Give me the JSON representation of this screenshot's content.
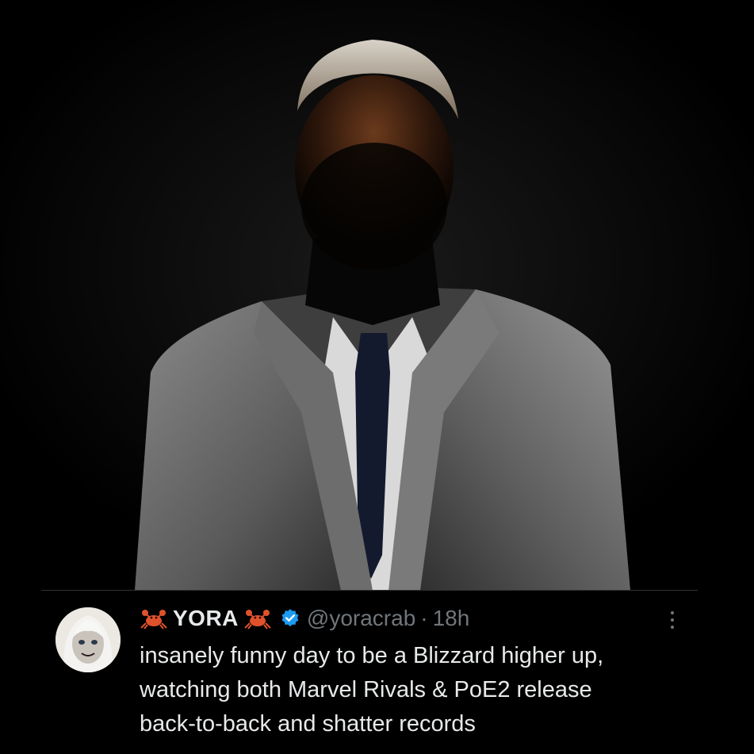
{
  "tweet": {
    "display_name": "YORA",
    "handle": "@yoracrab",
    "separator": "·",
    "time": "18h",
    "text_lines": [
      "insanely funny day to be a Blizzard higher up,",
      "watching both Marvel Rivals & PoE2 release",
      "back-to-back and shatter records"
    ],
    "icons": [
      "crab-emoji",
      "verified-badge",
      "more-options"
    ]
  },
  "colors": {
    "background": "#000000",
    "primary_text": "#e7e9ea",
    "secondary_text": "#71767b",
    "verified": "#1d9bf0",
    "crab": "#e0522c"
  }
}
